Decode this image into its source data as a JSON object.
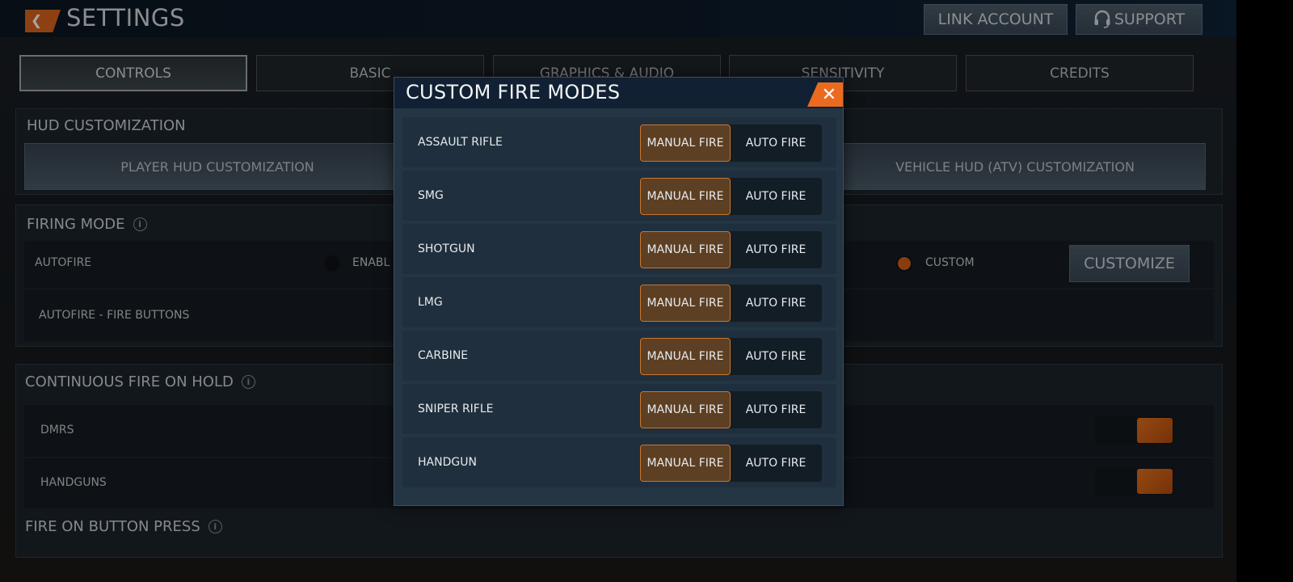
{
  "header": {
    "back_icon": "chevron-left-icon",
    "title": "SETTINGS",
    "link_account_label": "LINK ACCOUNT",
    "support_label": "SUPPORT",
    "support_icon": "headset-icon"
  },
  "tabs": [
    {
      "label": "CONTROLS",
      "active": true
    },
    {
      "label": "BASIC",
      "active": false
    },
    {
      "label": "GRAPHICS & AUDIO",
      "active": false
    },
    {
      "label": "SENSITIVITY",
      "active": false
    },
    {
      "label": "CREDITS",
      "active": false
    }
  ],
  "hud_customization": {
    "title": "HUD CUSTOMIZATION",
    "player_button": "PLAYER HUD CUSTOMIZATION",
    "vehicle_atv_button": "VEHICLE HUD (ATV) CUSTOMIZATION"
  },
  "firing_mode": {
    "title": "FIRING MODE",
    "autofire_label": "AUTOFIRE",
    "enable_option": "ENABL",
    "custom_option": "CUSTOM",
    "selected": "CUSTOM",
    "customize_button": "CUSTOMIZE",
    "fire_buttons_label": "AUTOFIRE - FIRE BUTTONS"
  },
  "continuous_fire": {
    "title": "CONTINUOUS FIRE ON HOLD",
    "rows": [
      {
        "label": "DMRS",
        "enabled": true
      },
      {
        "label": "HANDGUNS",
        "enabled": true
      }
    ]
  },
  "fire_on_button_press": {
    "title": "FIRE ON BUTTON PRESS"
  },
  "modal": {
    "title": "CUSTOM FIRE MODES",
    "close_icon": "close-icon",
    "manual_label": "MANUAL FIRE",
    "auto_label": "AUTO FIRE",
    "weapons": [
      {
        "name": "ASSAULT RIFLE",
        "mode": "MANUAL FIRE"
      },
      {
        "name": "SMG",
        "mode": "MANUAL FIRE"
      },
      {
        "name": "SHOTGUN",
        "mode": "MANUAL FIRE"
      },
      {
        "name": "LMG",
        "mode": "MANUAL FIRE"
      },
      {
        "name": "CARBINE",
        "mode": "MANUAL FIRE"
      },
      {
        "name": "SNIPER RIFLE",
        "mode": "MANUAL FIRE"
      },
      {
        "name": "HANDGUN",
        "mode": "MANUAL FIRE"
      }
    ]
  },
  "colors": {
    "accent": "#d9651e",
    "selected_segment": "#5d3f23",
    "selected_border": "#c9762e"
  }
}
